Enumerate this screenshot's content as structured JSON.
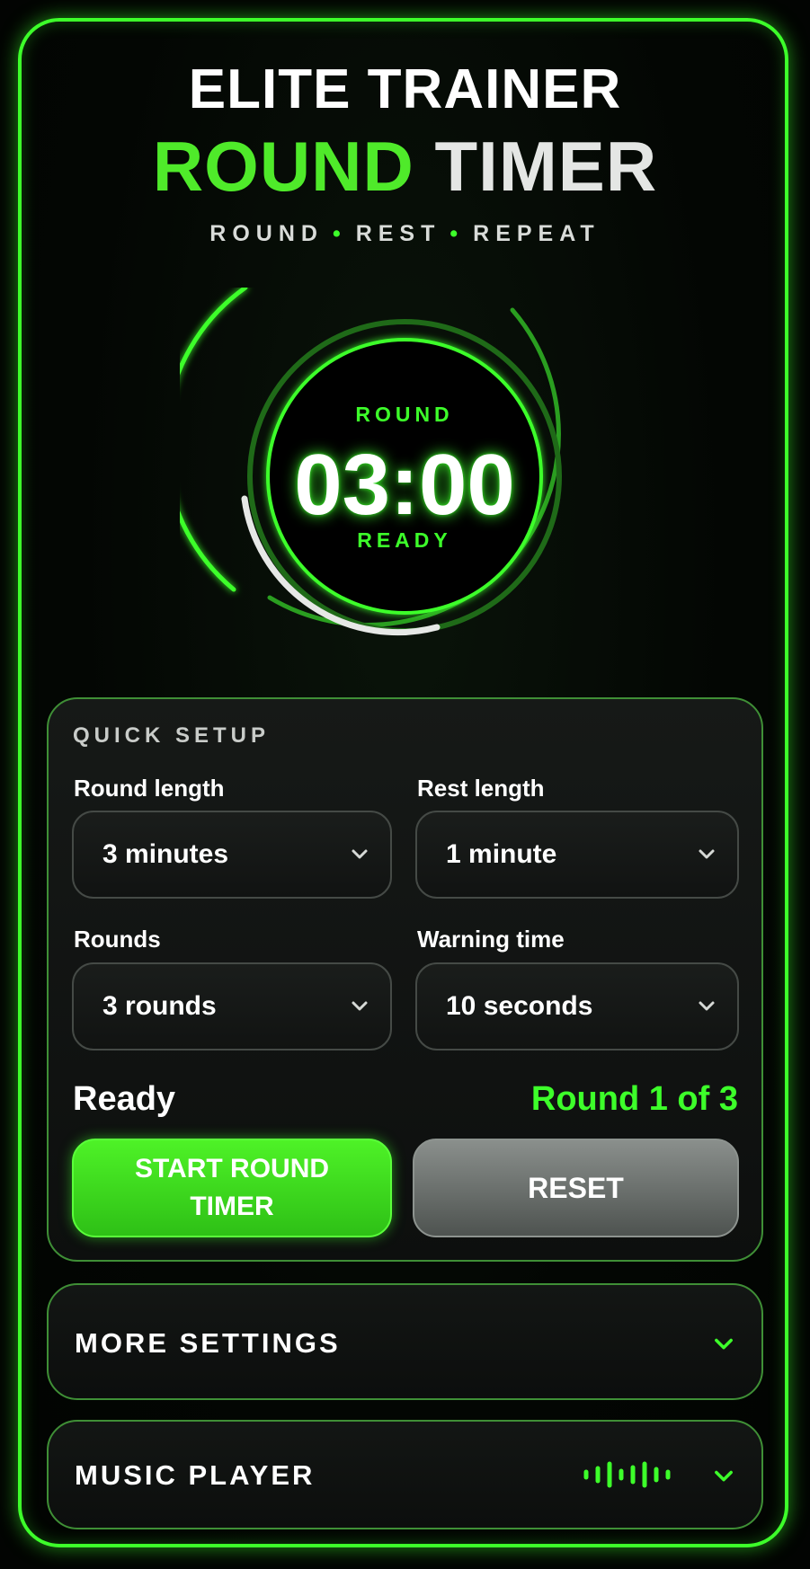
{
  "header": {
    "title_line1": "ELITE TRAINER",
    "title_line2_accent": "ROUND",
    "title_line2_rest": "TIMER",
    "tagline": [
      "ROUND",
      "REST",
      "REPEAT"
    ]
  },
  "timer": {
    "phase_label": "ROUND",
    "time": "03:00",
    "status_label": "READY",
    "progress": 0.25
  },
  "quick_setup": {
    "title": "QUICK SETUP",
    "round_length": {
      "label": "Round length",
      "value": "3 minutes"
    },
    "rest_length": {
      "label": "Rest length",
      "value": "1 minute"
    },
    "rounds": {
      "label": "Rounds",
      "value": "3 rounds"
    },
    "warning_time": {
      "label": "Warning time",
      "value": "10 seconds"
    },
    "status": "Ready",
    "round_counter": "Round 1 of 3",
    "start_label_line1": "START ROUND",
    "start_label_line2": "TIMER",
    "reset_label": "RESET"
  },
  "more_settings": {
    "title": "MORE SETTINGS"
  },
  "music_player": {
    "title": "MUSIC PLAYER"
  },
  "colors": {
    "accent": "#3dff2a",
    "background": "#020402",
    "button_reset": "#6e7370"
  },
  "icons": [
    "chevron-down-icon",
    "equalizer-icon"
  ]
}
